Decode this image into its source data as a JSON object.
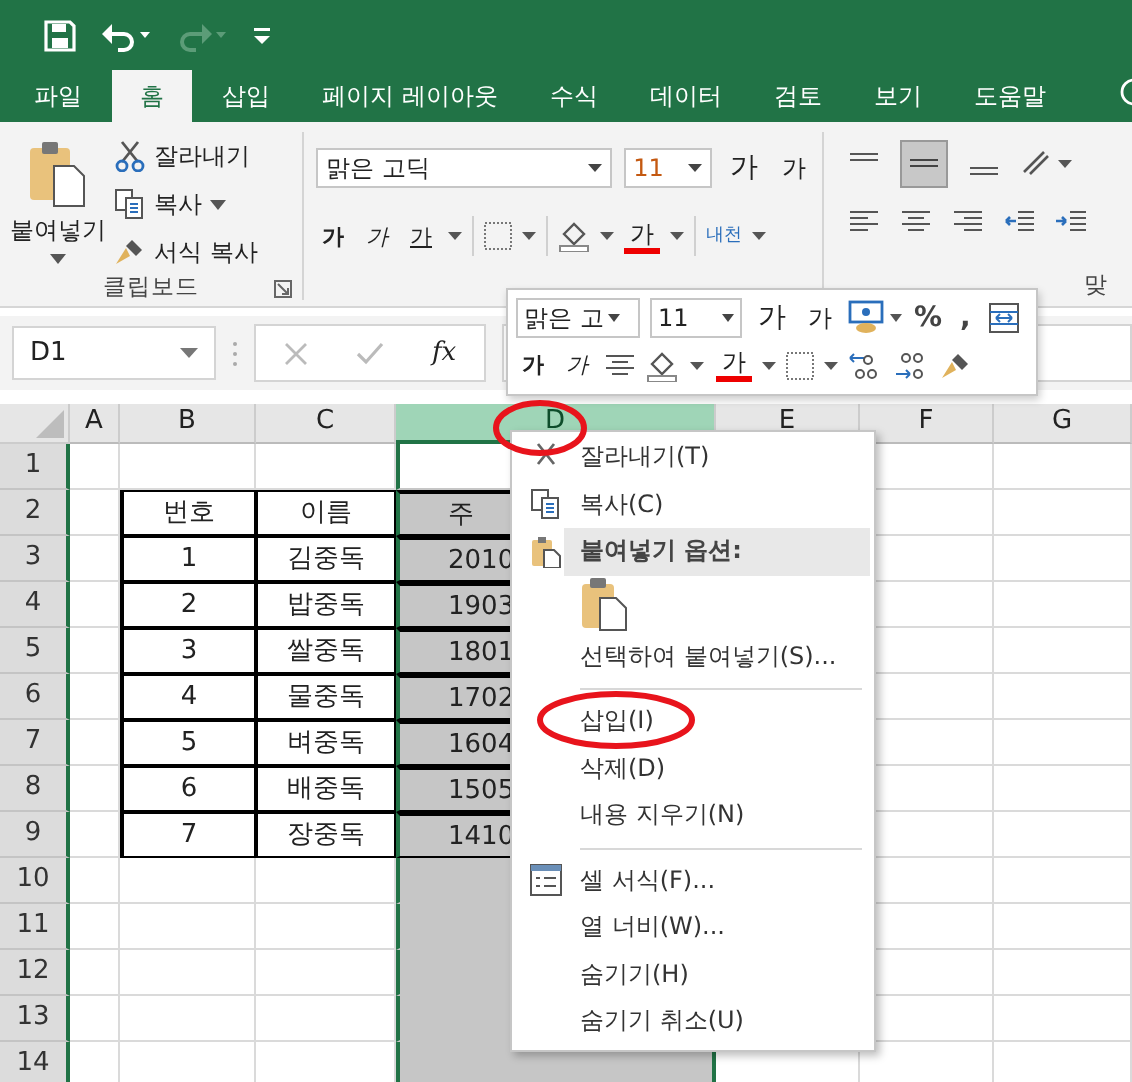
{
  "tabs": [
    {
      "label": "파일",
      "selected": false
    },
    {
      "label": "홈",
      "selected": true
    },
    {
      "label": "삽입",
      "selected": false
    },
    {
      "label": "페이지 레이아웃",
      "selected": false
    },
    {
      "label": "수식",
      "selected": false
    },
    {
      "label": "데이터",
      "selected": false
    },
    {
      "label": "검토",
      "selected": false
    },
    {
      "label": "보기",
      "selected": false
    },
    {
      "label": "도움말",
      "selected": false
    }
  ],
  "ribbon": {
    "clipboard": {
      "paste": "붙여넣기",
      "cut": "잘라내기",
      "copy": "복사",
      "format_painter": "서식 복사",
      "label": "클립보드"
    },
    "font": {
      "font_name": "맑은 고딕",
      "font_size": "11",
      "grow": "가",
      "shrink": "가",
      "bold": "가",
      "italic": "가",
      "underline": "가",
      "font_color": "가",
      "phonetic": "내천"
    },
    "alignment": {
      "label": "맞"
    }
  },
  "name_box": "D1",
  "formula_bar": {
    "function_label": "fx"
  },
  "mini_toolbar": {
    "font_name": "맑은 고",
    "font_size": "11",
    "grow": "가",
    "shrink": "가",
    "percent": "%",
    "comma": ",",
    "bold": "가",
    "italic": "가",
    "font_color": "가"
  },
  "sheet": {
    "columns": [
      {
        "label": "A",
        "selected": false
      },
      {
        "label": "B",
        "selected": false
      },
      {
        "label": "C",
        "selected": false
      },
      {
        "label": "D",
        "selected": true
      },
      {
        "label": "E",
        "selected": false
      },
      {
        "label": "F",
        "selected": false
      },
      {
        "label": "G",
        "selected": false
      }
    ],
    "rows": [
      {
        "number": "1"
      },
      {
        "number": "2",
        "b": "번호",
        "c": "이름",
        "d": "주"
      },
      {
        "number": "3",
        "b": "1",
        "c": "김중독",
        "d": "2010"
      },
      {
        "number": "4",
        "b": "2",
        "c": "밥중독",
        "d": "1903"
      },
      {
        "number": "5",
        "b": "3",
        "c": "쌀중독",
        "d": "1801"
      },
      {
        "number": "6",
        "b": "4",
        "c": "물중독",
        "d": "1702"
      },
      {
        "number": "7",
        "b": "5",
        "c": "벼중독",
        "d": "1604"
      },
      {
        "number": "8",
        "b": "6",
        "c": "배중독",
        "d": "1505"
      },
      {
        "number": "9",
        "b": "7",
        "c": "장중독",
        "d": "1410"
      },
      {
        "number": "10"
      },
      {
        "number": "11"
      },
      {
        "number": "12"
      },
      {
        "number": "13"
      },
      {
        "number": "14"
      }
    ]
  },
  "context_menu": {
    "items": [
      {
        "kind": "item",
        "label": "잘라내기(T)"
      },
      {
        "kind": "item",
        "label": "복사(C)"
      },
      {
        "kind": "header",
        "label": "붙여넣기 옵션:"
      },
      {
        "kind": "paste_option"
      },
      {
        "kind": "item",
        "label": "선택하여 붙여넣기(S)..."
      },
      {
        "kind": "separator"
      },
      {
        "kind": "item",
        "label": "삽입(I)"
      },
      {
        "kind": "item",
        "label": "삭제(D)"
      },
      {
        "kind": "item",
        "label": "내용 지우기(N)"
      },
      {
        "kind": "separator"
      },
      {
        "kind": "item",
        "label": "셀 서식(F)..."
      },
      {
        "kind": "item",
        "label": "열 너비(W)..."
      },
      {
        "kind": "item",
        "label": "숨기기(H)"
      },
      {
        "kind": "item",
        "label": "숨기기 취소(U)"
      }
    ]
  }
}
